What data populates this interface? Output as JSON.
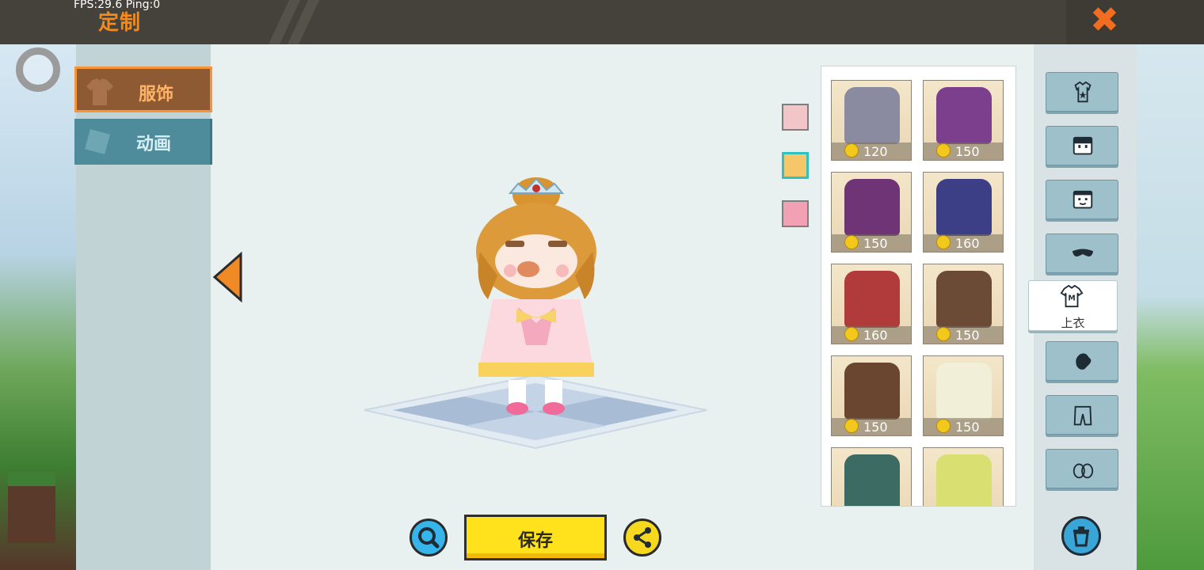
{
  "header": {
    "fps_text": "FPS:29.6  Ping:0",
    "title": "定制",
    "close_icon": "close-x-icon"
  },
  "tabs": [
    {
      "label": "服饰",
      "icon": "shirt-icon",
      "active": true
    },
    {
      "label": "动画",
      "icon": "animation-icon",
      "active": false
    }
  ],
  "color_options": [
    {
      "color": "#f2c6c9",
      "selected": false
    },
    {
      "color": "#f5c76a",
      "selected": true
    },
    {
      "color": "#f2a0b4",
      "selected": false
    }
  ],
  "items": [
    {
      "price": "120",
      "art_color": "#8a8aa0"
    },
    {
      "price": "150",
      "art_color": "#7b3f8e"
    },
    {
      "price": "150",
      "art_color": "#6f3475"
    },
    {
      "price": "160",
      "art_color": "#3d3f86"
    },
    {
      "price": "160",
      "art_color": "#b13a3a"
    },
    {
      "price": "150",
      "art_color": "#6b4a36"
    },
    {
      "price": "150",
      "art_color": "#6a4630"
    },
    {
      "price": "150",
      "art_color": "#f1efd8"
    },
    {
      "price": "",
      "art_color": "#3b6b63"
    },
    {
      "price": "",
      "art_color": "#d9e071"
    }
  ],
  "categories": [
    {
      "icon": "outfit-icon"
    },
    {
      "icon": "face-icon"
    },
    {
      "icon": "expression-icon"
    },
    {
      "icon": "mask-icon"
    },
    {
      "icon": "top-shirt-icon",
      "label": "上衣",
      "active": true
    },
    {
      "icon": "gloves-icon"
    },
    {
      "icon": "pants-icon"
    },
    {
      "icon": "shoes-icon"
    }
  ],
  "bottom": {
    "save_label": "保存",
    "zoom_icon": "magnifier-icon",
    "share_icon": "share-icon",
    "trash_icon": "trash-icon"
  },
  "accent_colors": {
    "orange": "#f28a1e",
    "panel": "#e8f0f0",
    "save": "#ffe21b"
  }
}
